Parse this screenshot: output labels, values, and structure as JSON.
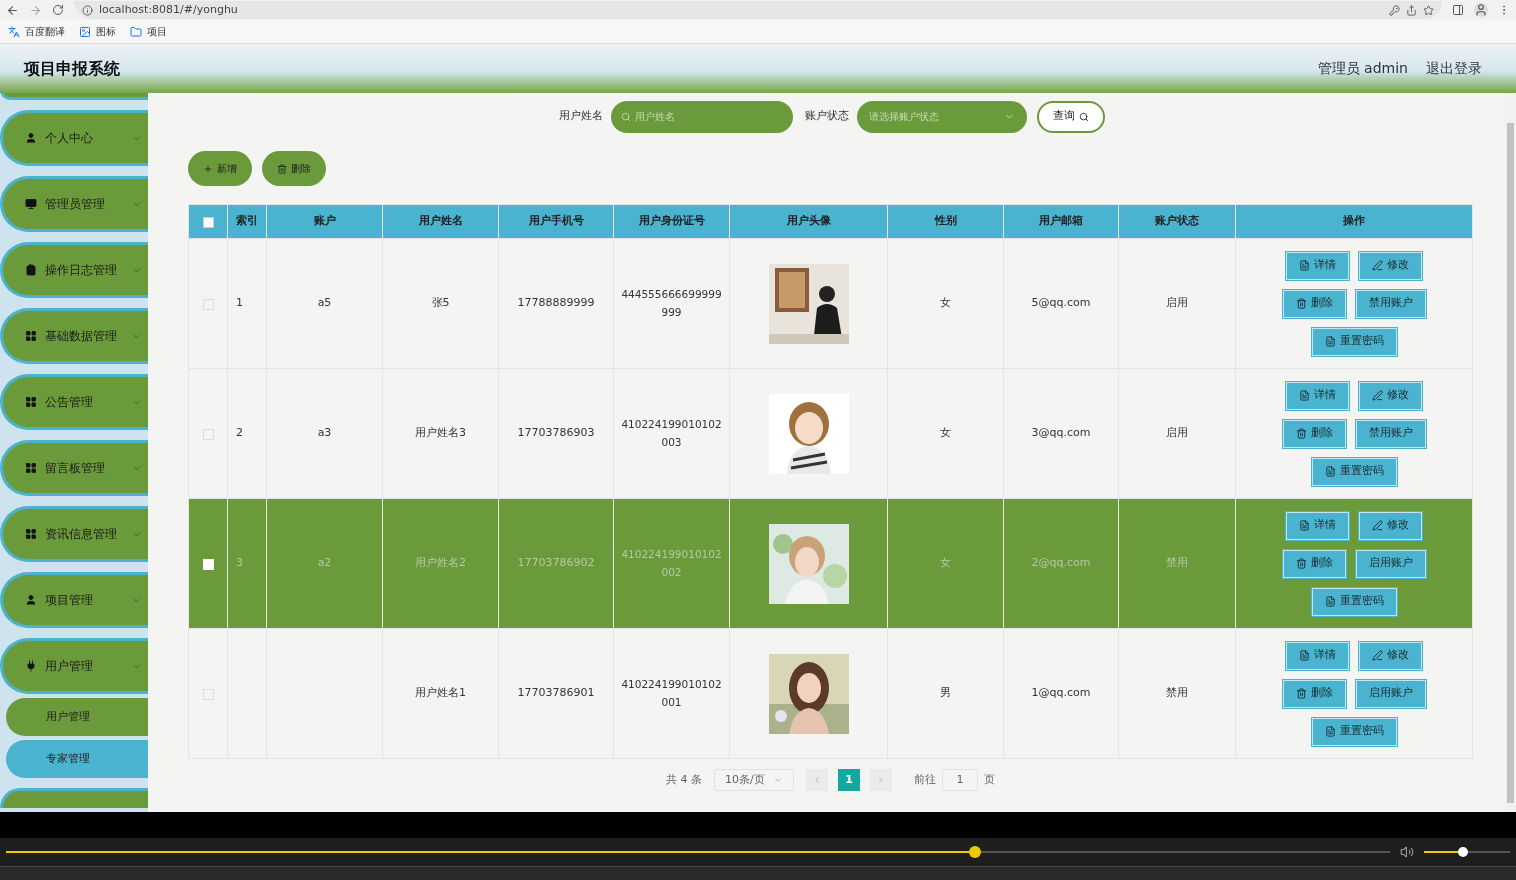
{
  "browser": {
    "url": "localhost:8081/#/yonghu",
    "bookmarks": [
      "百度翻译",
      "图标",
      "项目"
    ]
  },
  "header": {
    "title": "项目申报系统",
    "user": "管理员 admin",
    "logout": "退出登录"
  },
  "sidebar": {
    "items": [
      {
        "label": "个人中心"
      },
      {
        "label": "管理员管理"
      },
      {
        "label": "操作日志管理"
      },
      {
        "label": "基础数据管理"
      },
      {
        "label": "公告管理"
      },
      {
        "label": "留言板管理"
      },
      {
        "label": "资讯信息管理"
      },
      {
        "label": "项目管理"
      },
      {
        "label": "用户管理",
        "children": [
          {
            "label": "用户管理",
            "selected": false
          },
          {
            "label": "专家管理",
            "selected": true
          }
        ]
      }
    ]
  },
  "search": {
    "fields": [
      {
        "label": "用户姓名",
        "placeholder": "用户姓名",
        "kind": "input"
      },
      {
        "label": "账户状态",
        "placeholder": "请选择账户状态",
        "kind": "select"
      }
    ],
    "button": "查询"
  },
  "toolbar": [
    "新增",
    "删除"
  ],
  "table": {
    "select_all": {
      "checked": false
    },
    "columns": [
      "索引",
      "账户",
      "用户姓名",
      "用户手机号",
      "用户身份证号",
      "用户头像",
      "性别",
      "用户邮箱",
      "账户状态",
      "操作"
    ],
    "rows": [
      {
        "checked": false,
        "selected": false,
        "index": "1",
        "account": "a5",
        "name": "张5",
        "phone": "17788889999",
        "id_number": "444555666699999999",
        "gender": "女",
        "email": "5@qq.com",
        "status": "启用",
        "actions": [
          "详情",
          "修改",
          "删除",
          "禁用账户",
          "重置密码"
        ]
      },
      {
        "checked": false,
        "selected": false,
        "index": "2",
        "account": "a3",
        "name": "用户姓名3",
        "phone": "17703786903",
        "id_number": "410224199010102003",
        "gender": "女",
        "email": "3@qq.com",
        "status": "启用",
        "actions": [
          "详情",
          "修改",
          "删除",
          "禁用账户",
          "重置密码"
        ]
      },
      {
        "checked": false,
        "selected": true,
        "index": "3",
        "account": "a2",
        "name": "用户姓名2",
        "phone": "17703786902",
        "id_number": "410224199010102002",
        "gender": "女",
        "email": "2@qq.com",
        "status": "禁用",
        "actions": [
          "详情",
          "修改",
          "删除",
          "启用账户",
          "重置密码"
        ]
      },
      {
        "checked": false,
        "selected": false,
        "name": "用户姓名1",
        "phone": "17703786901",
        "id_number": "410224199010102001",
        "gender": "男",
        "email": "1@qq.com",
        "status": "禁用",
        "actions": [
          "详情",
          "修改",
          "删除",
          "启用账户",
          "重置密码"
        ]
      }
    ]
  },
  "pagination": {
    "total": "共 4 条",
    "page_size": "10条/页",
    "pages": [
      {
        "label": "1",
        "selected": true
      }
    ],
    "goto_label": "前往",
    "goto_value": "1",
    "page_suffix": "页"
  },
  "player": {
    "progress": {
      "level": 0.7
    },
    "volume": {
      "level": 0.45
    }
  }
}
